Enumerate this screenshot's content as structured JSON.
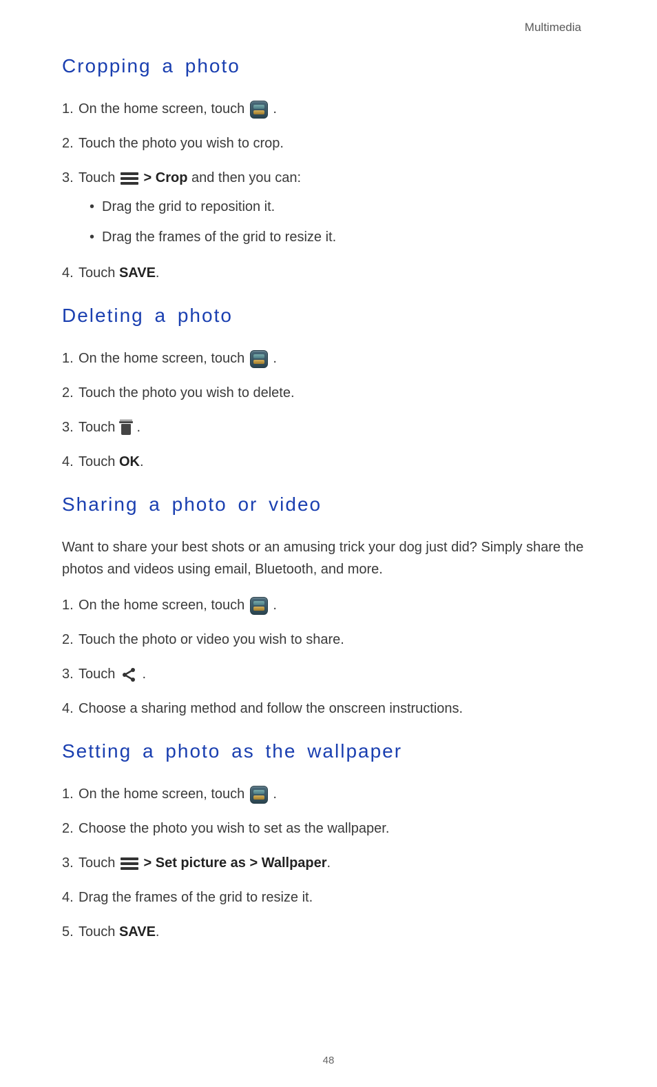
{
  "header": {
    "category": "Multimedia"
  },
  "page_number": "48",
  "icons": {
    "gallery": "gallery-app-icon",
    "menu": "menu-icon",
    "trash": "trash-icon",
    "share": "share-icon"
  },
  "sections": [
    {
      "id": "cropping",
      "heading": "Cropping a photo",
      "steps": [
        {
          "pre": "On the home screen, touch ",
          "icon": "gallery",
          "post": " ."
        },
        {
          "text": "Touch the photo you wish to crop."
        },
        {
          "pre": "Touch ",
          "icon": "menu",
          "post_bold_prefix": " > ",
          "bold": "Crop",
          "post": " and then you can:",
          "sub": [
            "Drag the grid to reposition it.",
            "Drag the frames of the grid to resize it."
          ]
        },
        {
          "pre": "Touch ",
          "bold": "SAVE",
          "post": "."
        }
      ]
    },
    {
      "id": "deleting",
      "heading": "Deleting a photo",
      "steps": [
        {
          "pre": "On the home screen, touch ",
          "icon": "gallery",
          "post": " ."
        },
        {
          "text": "Touch the photo you wish to delete."
        },
        {
          "pre": "Touch ",
          "icon": "trash",
          "post": " ."
        },
        {
          "pre": "Touch ",
          "bold": "OK",
          "post": "."
        }
      ]
    },
    {
      "id": "sharing",
      "heading": "Sharing a photo or video",
      "intro": "Want to share your best shots or an amusing trick your dog just did? Simply share the photos and videos using email, Bluetooth, and more.",
      "steps": [
        {
          "pre": "On the home screen, touch ",
          "icon": "gallery",
          "post": " ."
        },
        {
          "text": "Touch the photo or video you wish to share."
        },
        {
          "pre": "Touch ",
          "icon": "share",
          "post": " ."
        },
        {
          "text": "Choose a sharing method and follow the onscreen instructions."
        }
      ]
    },
    {
      "id": "wallpaper",
      "heading": "Setting a photo as the wallpaper",
      "steps": [
        {
          "pre": "On the home screen, touch ",
          "icon": "gallery",
          "post": " ."
        },
        {
          "text": "Choose the photo you wish to set as the wallpaper."
        },
        {
          "pre": "Touch ",
          "icon": "menu",
          "post_bold_prefix": " > ",
          "bold": "Set picture as > Wallpaper",
          "post": "."
        },
        {
          "text": "Drag the frames of the grid to resize it."
        },
        {
          "pre": "Touch ",
          "bold": "SAVE",
          "post": "."
        }
      ]
    }
  ]
}
